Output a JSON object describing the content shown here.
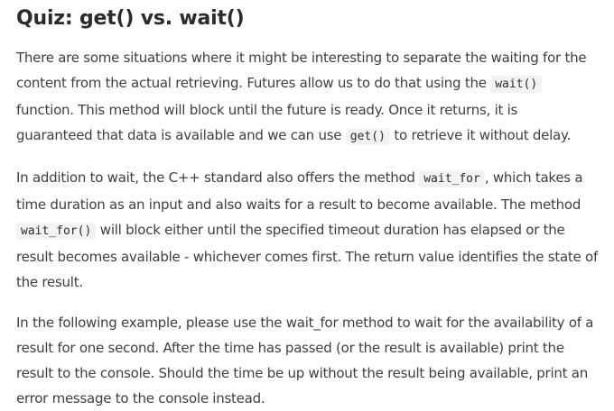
{
  "title": "Quiz: get() vs. wait()",
  "p1": {
    "t1": "There are some situations where it might be interesting to separate the waiting for the content from the actual retrieving. Futures allow us to do that using the ",
    "c1": "wait()",
    "t2": " function. This method will block until the future is ready. Once it returns, it is guaranteed that data is available and we can use ",
    "c2": "get()",
    "t3": " to retrieve it without delay."
  },
  "p2": {
    "t1": "In addition to wait, the C++ standard also offers the method ",
    "c1": "wait_for",
    "t2": ", which takes a time duration as an input and also waits for a result to become available. The method ",
    "c2": "wait_for()",
    "t3": " will block either until the specified timeout duration has elapsed or the result becomes available - whichever comes first. The return value identifies the state of the result."
  },
  "p3": {
    "t1": "In the following example, please use the wait_for method to wait for the availability of a result for one second. After the time has passed (or the result is available) print the result to the console. Should the time be up without the result being available, print an error message to the console instead."
  }
}
